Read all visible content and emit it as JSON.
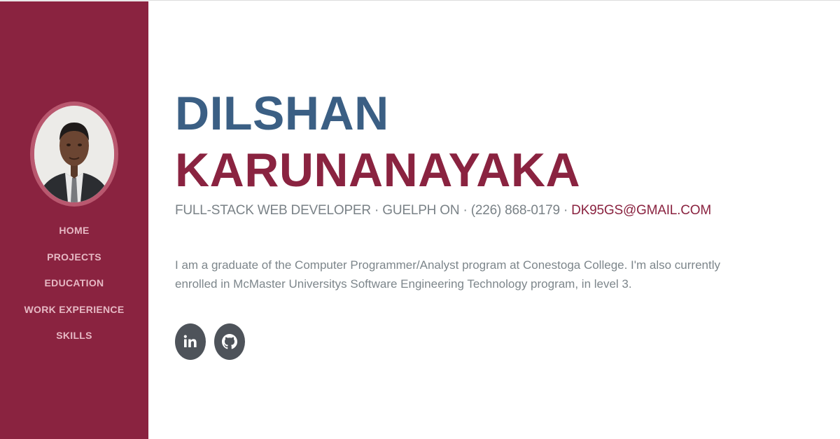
{
  "sidebar": {
    "nav": [
      {
        "label": "HOME"
      },
      {
        "label": "PROJECTS"
      },
      {
        "label": "EDUCATION"
      },
      {
        "label": "WORK EXPERIENCE"
      },
      {
        "label": "SKILLS"
      }
    ]
  },
  "profile": {
    "first_name": "DILSHAN",
    "last_name": "KARUNANAYAKA",
    "role": "FULL-STACK WEB DEVELOPER",
    "location": "GUELPH ON",
    "phone": "(226) 868-0179",
    "email": "DK95GS@GMAIL.COM",
    "separator": "·",
    "bio": "I am a graduate of the Computer Programmer/Analyst program at Conestoga College. I'm also currently enrolled in McMaster Universitys Software Engineering Technology program, in level 3."
  },
  "social": [
    {
      "icon": "linkedin-icon"
    },
    {
      "icon": "github-icon"
    }
  ],
  "colors": {
    "sidebar_bg": "#8a2340",
    "first_name": "#3b5f84",
    "last_name": "#8a2340",
    "nav_text": "#e6b9c4",
    "muted_text": "#7a8287",
    "social_bg": "#4e535a"
  }
}
